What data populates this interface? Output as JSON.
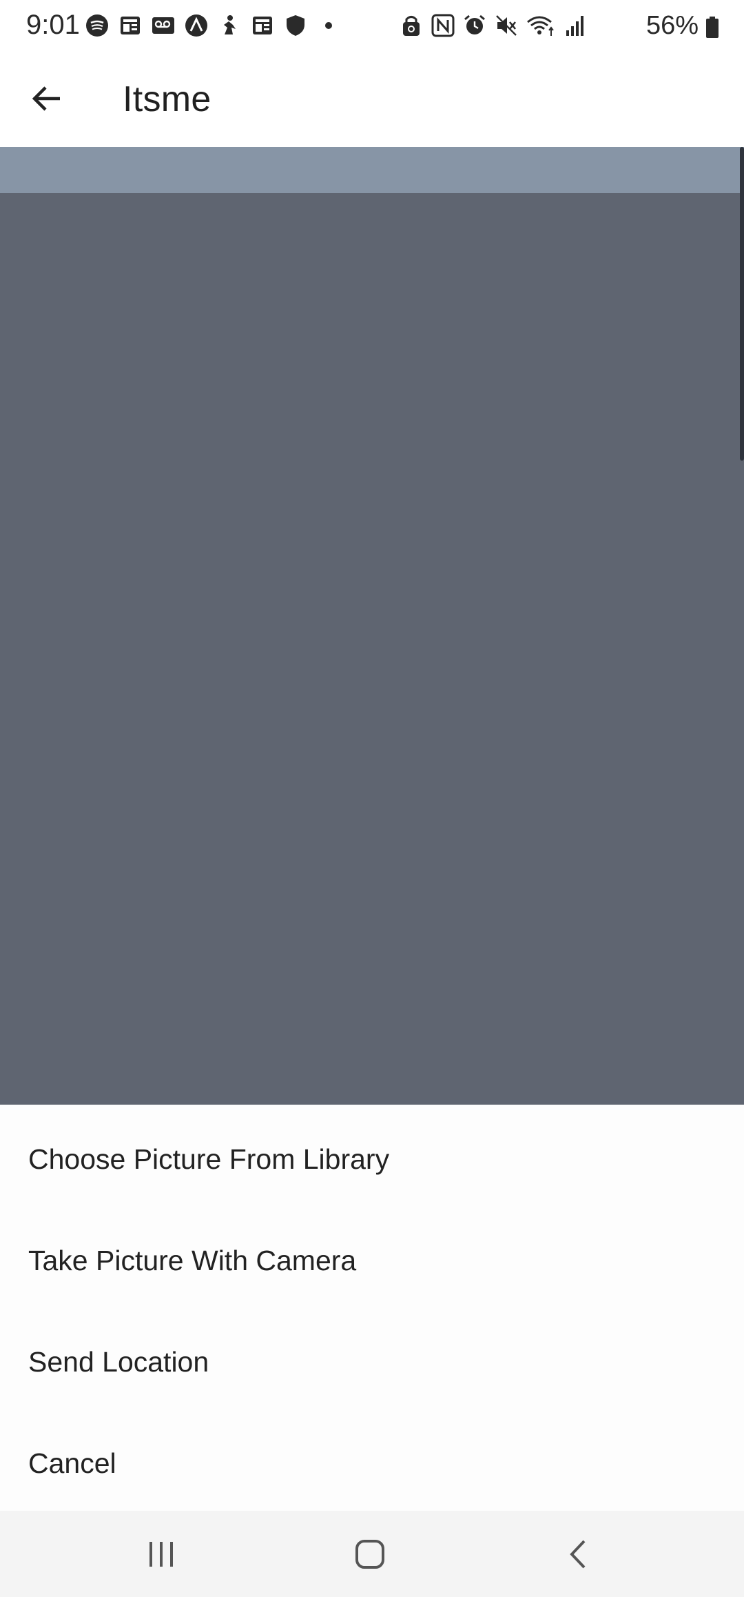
{
  "status_bar": {
    "time": "9:01",
    "battery_percent": "56%",
    "left_icons": [
      "spotify-icon",
      "news-icon",
      "voicemail-icon",
      "app-icon",
      "fitness-icon",
      "news-icon-2",
      "shield-icon",
      "dot-icon"
    ],
    "right_icons": [
      "lock-icon",
      "nfc-icon",
      "alarm-icon",
      "mute-icon",
      "wifi-icon",
      "signal-icon"
    ]
  },
  "app_bar": {
    "title": "Itsme",
    "back_icon": "arrow-left-icon"
  },
  "sheet": {
    "items": [
      {
        "label": "Choose Picture From Library"
      },
      {
        "label": "Take Picture With Camera"
      },
      {
        "label": "Send Location"
      },
      {
        "label": "Cancel"
      }
    ]
  },
  "nav_bar": {
    "icons": [
      "recents-icon",
      "home-icon",
      "back-icon"
    ]
  },
  "colors": {
    "strip": "#8795a6",
    "overlay": "#5f6571",
    "sheet": "#fdfdfd",
    "nav": "#f4f4f4"
  }
}
